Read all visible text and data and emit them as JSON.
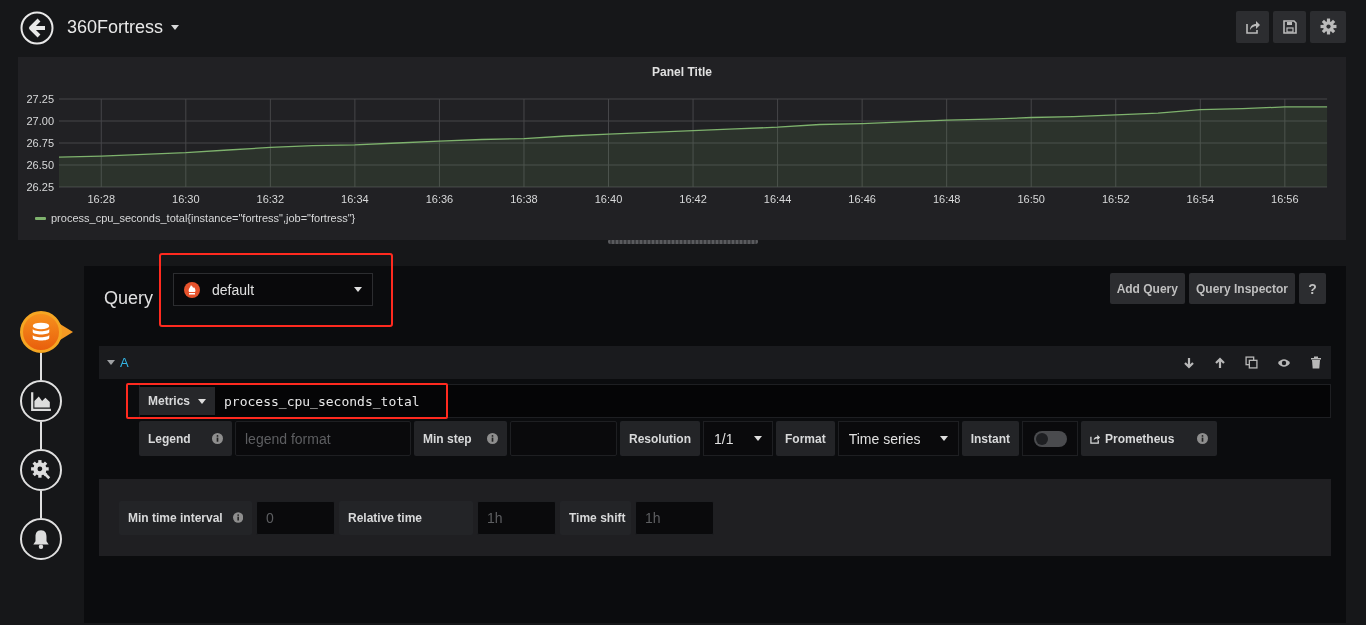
{
  "header": {
    "title": "360Fortress",
    "buttons": [
      {
        "kind": "share"
      },
      {
        "kind": "save"
      },
      {
        "kind": "settings"
      }
    ]
  },
  "panel": {
    "title": "Panel Title",
    "chart_data": {
      "type": "area",
      "grid": true,
      "categories": [
        null,
        "16:28",
        null,
        "16:30",
        null,
        "16:32",
        null,
        "16:34",
        null,
        "16:36",
        null,
        "16:38",
        null,
        "16:40",
        null,
        "16:42",
        null,
        "16:44",
        null,
        "16:46",
        null,
        "16:48",
        null,
        "16:50",
        null,
        "16:52",
        null,
        "16:54",
        null,
        "16:56",
        null
      ],
      "series": [
        {
          "name": "process_cpu_seconds_total{instance=\"fortress\",job=\"fortress\"}",
          "color": "#7eb26d",
          "values": [
            26.59,
            26.6,
            26.62,
            26.64,
            26.67,
            26.7,
            26.72,
            26.73,
            26.75,
            26.77,
            26.79,
            26.8,
            26.83,
            26.85,
            26.87,
            26.89,
            26.91,
            26.93,
            26.96,
            26.97,
            26.99,
            27.01,
            27.02,
            27.04,
            27.05,
            27.07,
            27.09,
            27.13,
            27.14,
            27.16,
            27.16
          ]
        }
      ],
      "ylim": [
        26.25,
        27.25
      ],
      "yticks": [
        {
          "value": 26.25,
          "label": "26.25"
        },
        {
          "value": 26.5,
          "label": "26.50"
        },
        {
          "value": 26.75,
          "label": "26.75"
        },
        {
          "value": 27,
          "label": "27.00"
        },
        {
          "value": 27.25,
          "label": "27.25"
        }
      ]
    }
  },
  "steps": [
    {
      "kind": "queries",
      "selected": true
    },
    {
      "kind": "visualization",
      "selected": false
    },
    {
      "kind": "general",
      "selected": false
    },
    {
      "kind": "alert",
      "selected": false
    }
  ],
  "query": {
    "label": "Query",
    "datasource": {
      "value": "default",
      "highlighted": true
    },
    "buttons": [
      "Add Query",
      "Query Inspector",
      "?"
    ]
  },
  "queries": [
    {
      "ref": "A",
      "expanded": true,
      "actions": [
        {
          "kind": "down"
        },
        {
          "kind": "up"
        },
        {
          "kind": "copy"
        },
        {
          "kind": "eye"
        },
        {
          "kind": "trash"
        }
      ],
      "metrics": {
        "label": "Metrics",
        "value": "process_cpu_seconds_total",
        "highlighted": true
      },
      "options": [
        {
          "kind": "input",
          "label": "Legend",
          "info": true,
          "placeholder": "legend format"
        },
        {
          "kind": "input",
          "label": "Min step",
          "info": true
        },
        {
          "kind": "select",
          "label": "Resolution",
          "value": "1/1"
        },
        {
          "kind": "select",
          "label": "Format",
          "value": "Time series"
        },
        {
          "kind": "switch",
          "label": "Instant",
          "on": false
        },
        {
          "kind": "link",
          "label": "Prometheus",
          "info": true
        }
      ]
    }
  ],
  "options": [
    {
      "label": "Min time interval",
      "info": true,
      "placeholder": "0"
    },
    {
      "label": "Relative time",
      "info": false,
      "placeholder": "1h"
    },
    {
      "label": "Time shift",
      "info": false,
      "placeholder": "1h"
    }
  ]
}
